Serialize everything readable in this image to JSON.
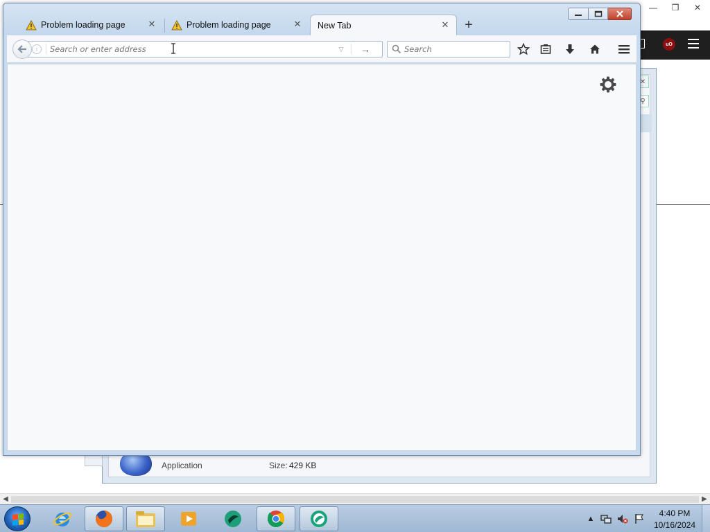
{
  "tabs": [
    {
      "label": "Problem loading page",
      "active": false
    },
    {
      "label": "Problem loading page",
      "active": false
    },
    {
      "label": "New Tab",
      "active": true
    }
  ],
  "toolbar": {
    "url_placeholder": "Search or enter address",
    "search_placeholder": "Search"
  },
  "icons": {
    "back": "back-arrow-icon",
    "info": "info-icon",
    "dropmarker": "dropdown-arrow-icon",
    "go": "go-arrow-icon",
    "search": "magnifier-icon",
    "bookmark": "star-icon",
    "reading_list": "clipboard-icon",
    "downloads": "download-arrow-icon",
    "home": "home-icon",
    "menu": "hamburger-menu-icon",
    "settings": "gear-icon"
  },
  "properties_dialog": {
    "type_text": "Application",
    "size_label": "Size:",
    "size_value": "429 KB"
  },
  "taskbar": {
    "apps": [
      {
        "name": "internet-explorer",
        "open": false
      },
      {
        "name": "firefox",
        "open": true
      },
      {
        "name": "file-explorer",
        "open": true
      },
      {
        "name": "media-player",
        "open": false
      },
      {
        "name": "green-app",
        "open": false
      },
      {
        "name": "chrome",
        "open": true
      },
      {
        "name": "green-app-2",
        "open": true
      }
    ],
    "clock_time": "4:40 PM",
    "clock_date": "10/16/2024"
  },
  "colors": {
    "titlebar": "#c7daef",
    "close_button": "#c0402c",
    "content_bg": "#f8f9fa",
    "taskbar": "#a9c0d9"
  }
}
